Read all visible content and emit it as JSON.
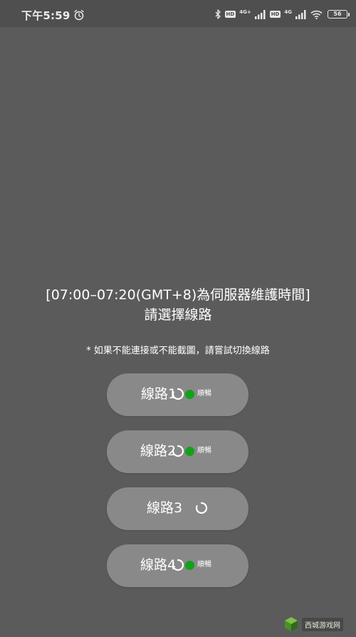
{
  "status_bar": {
    "time": "下午5:59",
    "hd1": "HD",
    "net1": "4G+",
    "hd2": "HD",
    "net2": "4G",
    "battery": "56"
  },
  "dialog": {
    "title_line1": "[07:00–07:20(GMT+8)為伺服器維護時間]",
    "title_line2": "請選擇線路",
    "notice": "* 如果不能連接或不能截圖，請嘗試切換線路"
  },
  "routes": [
    {
      "label": "線路",
      "number": "1",
      "status": "順暢",
      "status_color": "#11a11a",
      "loading": false
    },
    {
      "label": "線路",
      "number": "2",
      "status": "順暢",
      "status_color": "#11a11a",
      "loading": false
    },
    {
      "label": "線路",
      "number": "3",
      "status": "",
      "loading": true
    },
    {
      "label": "線路",
      "number": "4",
      "status": "順暢",
      "status_color": "#11a11a",
      "loading": false
    }
  ],
  "watermark": {
    "text": "西城游戏网"
  },
  "colors": {
    "background": "#5b5b5b",
    "button": "#898989",
    "status_green": "#11a11a"
  }
}
